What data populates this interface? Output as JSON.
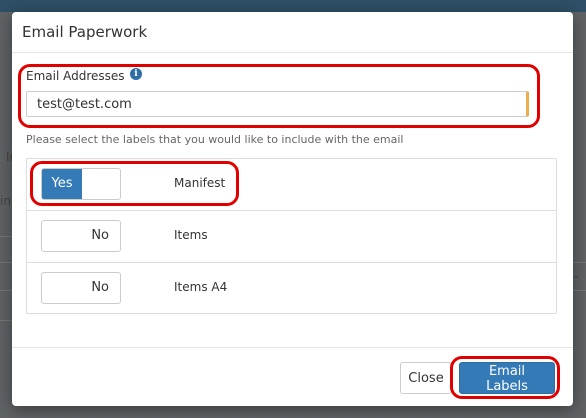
{
  "background": {
    "fragments": [
      "In",
      "in"
    ]
  },
  "modal": {
    "title": "Email Paperwork",
    "email": {
      "label": "Email Addresses",
      "info_icon": "i",
      "value": "test@test.com"
    },
    "instruction": "Please select the labels that you would like to include with the email",
    "labels": [
      {
        "name": "Manifest",
        "toggle_text": "Yes",
        "state": "on"
      },
      {
        "name": "Items",
        "toggle_text": "No",
        "state": "off"
      },
      {
        "name": "Items A4",
        "toggle_text": "No",
        "state": "off"
      }
    ],
    "buttons": {
      "close": "Close",
      "send": "Email Labels"
    }
  },
  "colors": {
    "primary": "#337ab7",
    "highlight": "#e00000",
    "input_accent": "#f0ad4e",
    "topbar": "#2e4f66"
  }
}
